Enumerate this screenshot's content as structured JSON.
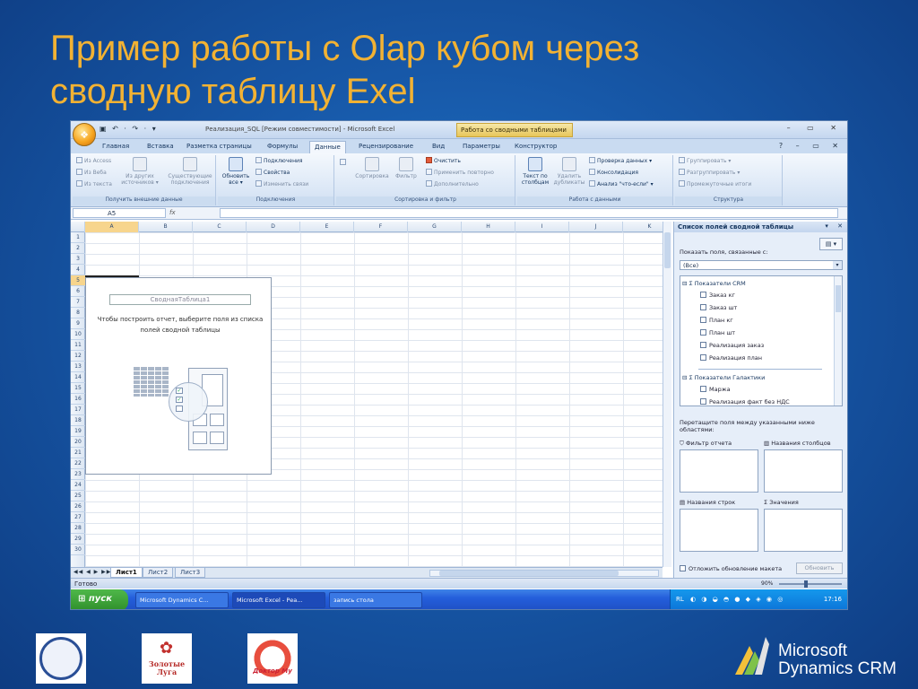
{
  "slide": {
    "title_line1": "Пример работы с Olap кубом через",
    "title_line2": "сводную таблицу Exel"
  },
  "excel": {
    "qat": "▣ ↶ · ↷ · ▾",
    "window_title": "Реализация_SQL  [Режим совместимости] - Microsoft Excel",
    "context_tab_title": "Работа со сводными таблицами",
    "window_controls": "– ▭ ✕",
    "tabs": [
      "Главная",
      "Вставка",
      "Разметка страницы",
      "Формулы",
      "Данные",
      "Рецензирование",
      "Вид",
      "Параметры",
      "Конструктор"
    ],
    "active_tab_index": 4,
    "tabs_right": "? – ▭ ✕",
    "ribbon": {
      "groups": [
        {
          "label": "Получить внешние данные",
          "items": [
            "Из Access",
            "Из Веба",
            "Из текста",
            "Из других источников ▾",
            "Существующие подключения"
          ]
        },
        {
          "label": "Подключения",
          "items": [
            "Обновить все ▾",
            "Подключения",
            "Свойства",
            "Изменить связи"
          ]
        },
        {
          "label": "Сортировка и фильтр",
          "items": [
            "Сортировка",
            "Фильтр",
            "Очистить",
            "Применить повторно",
            "Дополнительно"
          ]
        },
        {
          "label": "Работа с данными",
          "items": [
            "Текст по столбцам",
            "Удалить дубликаты",
            "Проверка данных ▾",
            "Консолидация",
            "Анализ \"что-если\" ▾"
          ]
        },
        {
          "label": "Структура",
          "items": [
            "Группировать ▾",
            "Разгруппировать ▾",
            "Промежуточные итоги"
          ]
        }
      ]
    },
    "namebox": "A5",
    "fx": "fx",
    "columns": [
      "A",
      "B",
      "C",
      "D",
      "E",
      "F",
      "G",
      "H",
      "I",
      "J",
      "K"
    ],
    "rows": [
      "1",
      "2",
      "3",
      "4",
      "5",
      "6",
      "7",
      "8",
      "9",
      "10",
      "11",
      "12",
      "13",
      "14",
      "15",
      "16",
      "17",
      "18",
      "19",
      "20",
      "21",
      "22",
      "23",
      "24",
      "25",
      "26",
      "27",
      "28",
      "29",
      "30"
    ],
    "pivot": {
      "name": "СводнаяТаблица1",
      "hint": "Чтобы построить отчет, выберите поля из списка полей сводной таблицы"
    },
    "sheet_nav": "◀◀ ◀ ▶ ▶▶",
    "sheets": [
      "Лист1",
      "Лист2",
      "Лист3"
    ],
    "active_sheet_index": 0,
    "status": "Готово",
    "zoom": "90%",
    "field_list": {
      "title": "Список полей сводной таблицы",
      "show_related_label": "Показать поля, связанные с:",
      "filter_value": "(Все)",
      "groups": [
        {
          "name": "Показатели CRM",
          "fields": [
            "Заказ кг",
            "Заказ шт",
            "План кг",
            "План шт",
            "Реализация заказ",
            "Реализация план"
          ]
        },
        {
          "name": "Показатели Галактики",
          "fields": [
            "Маржа",
            "Реализация факт без НДС"
          ]
        }
      ],
      "drag_hint": "Перетащите поля между указанными ниже областями:",
      "areas": {
        "report_filter": "Фильтр отчета",
        "column_labels": "Названия столбцов",
        "row_labels": "Названия строк",
        "values": "Значения"
      },
      "defer_update": "Отложить обновление макета",
      "update_button": "Обновить"
    },
    "taskbar": {
      "start": "пуск",
      "tasks": [
        "Microsoft Dynamics C...",
        "Microsoft Excel - Реа...",
        "запись стола"
      ],
      "lang": "RL",
      "clock": "17:16"
    }
  },
  "logos": {
    "logo2_line1": "Золотые",
    "logo2_line2": "Луга",
    "logo3": "Доктор Му"
  },
  "brand": {
    "line1": "Microsoft",
    "line2": "Dynamics CRM"
  }
}
